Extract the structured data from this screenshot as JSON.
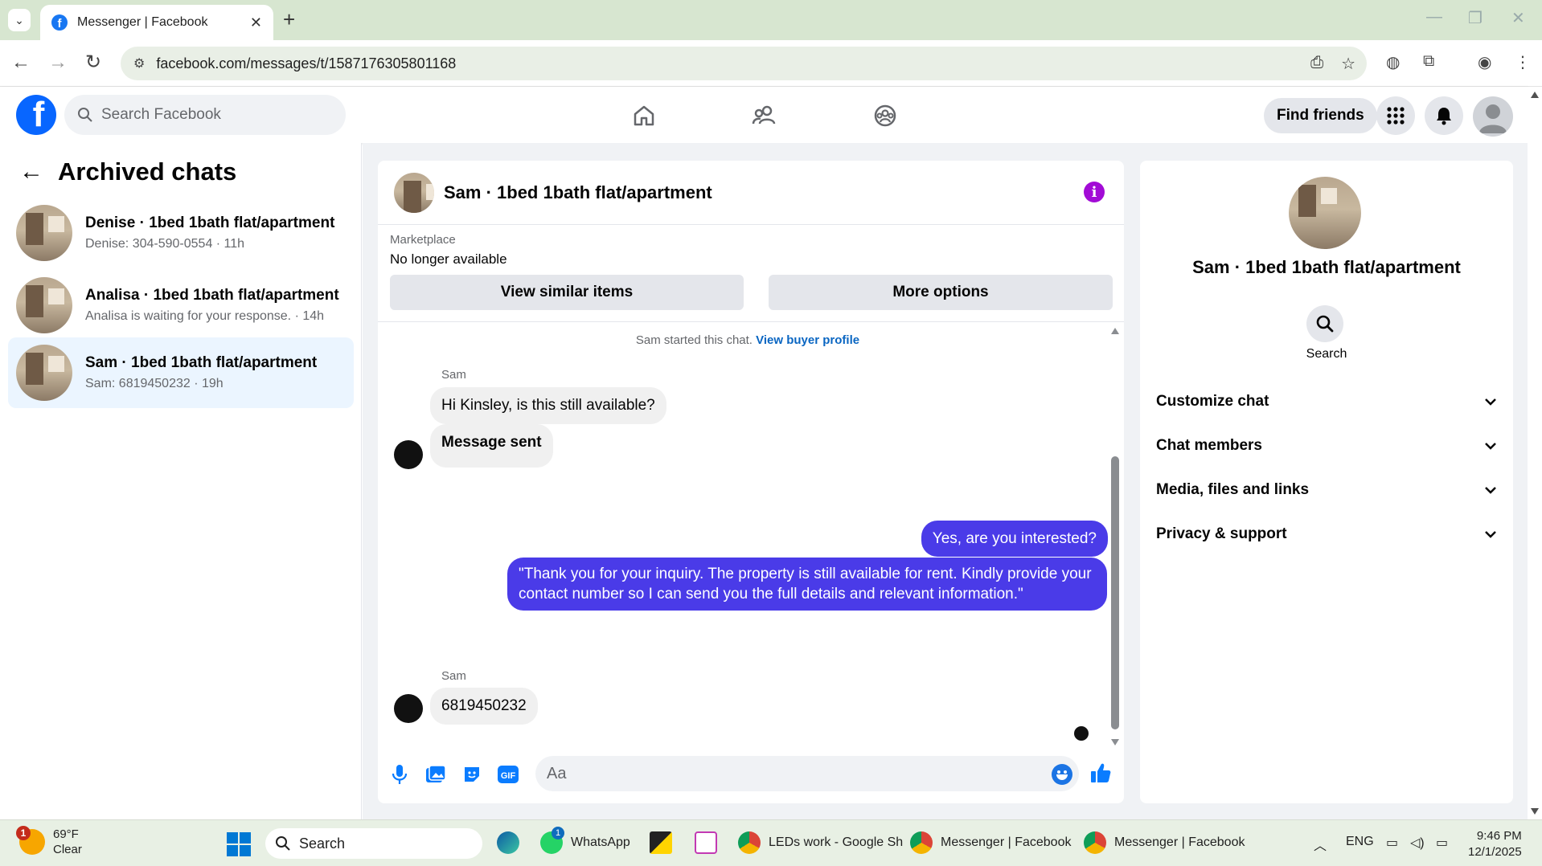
{
  "browser": {
    "tab_title": "Messenger | Facebook",
    "url": "facebook.com/messages/t/1587176305801168"
  },
  "fb": {
    "search_placeholder": "Search Facebook",
    "find_friends": "Find friends"
  },
  "left": {
    "title": "Archived chats",
    "chats": [
      {
        "name": "Denise · 1bed 1bath flat/apartment",
        "sub": "Denise: 304-590-0554 · 11h",
        "active": false
      },
      {
        "name": "Analisa · 1bed 1bath flat/apartment",
        "sub": "Analisa is waiting for your response. · 14h",
        "active": false
      },
      {
        "name": "Sam · 1bed 1bath flat/apartment",
        "sub": "Sam: 6819450232 · 19h",
        "active": true
      }
    ]
  },
  "chat": {
    "title": "Sam · 1bed 1bath flat/apartment",
    "marketplace_label": "Marketplace",
    "listing_status": "No longer available",
    "view_similar": "View similar items",
    "more_options": "More options",
    "started_text": "Sam started this chat.",
    "buyer_profile_link": "View buyer profile",
    "messages": {
      "sender1": "Sam",
      "in1": "Hi Kinsley, is this still available?",
      "in2": "Message sent",
      "out1": "Yes, are you interested?",
      "out2": "\"Thank you for your inquiry. The property is still available for rent. Kindly provide your contact number so I can send you the full details and relevant information.\"",
      "sender2": "Sam",
      "in3": "6819450232"
    },
    "input_placeholder": "Aa"
  },
  "info": {
    "name": "Sam · 1bed 1bath flat/apartment",
    "search_label": "Search",
    "sections": [
      "Customize chat",
      "Chat members",
      "Media, files and links",
      "Privacy & support"
    ]
  },
  "taskbar": {
    "weather_badge": "1",
    "temp": "69°F",
    "condition": "Clear",
    "search": "Search",
    "whatsapp": "WhatsApp",
    "whatsapp_badge": "1",
    "app_sheets": "LEDs work - Google Sh",
    "app_messenger1": "Messenger | Facebook",
    "app_messenger2": "Messenger | Facebook",
    "lang": "ENG",
    "time": "9:46 PM",
    "date": "12/1/2025"
  },
  "colors": {
    "fb_blue": "#0866ff",
    "outgoing_bubble": "#4a3be8",
    "active_chat_bg": "#ebf5ff",
    "info_icon": "#a20bd6"
  }
}
